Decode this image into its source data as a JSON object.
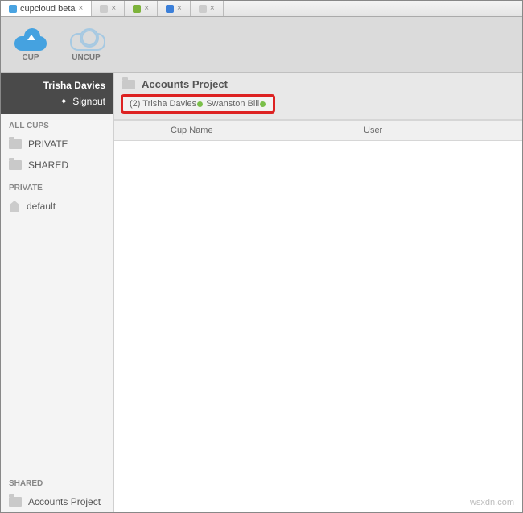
{
  "tabs": [
    {
      "label": "cupcloud beta",
      "favClass": ""
    },
    {
      "label": "",
      "favClass": "g"
    },
    {
      "label": "",
      "favClass": "gr"
    },
    {
      "label": "",
      "favClass": "bl"
    },
    {
      "label": "",
      "favClass": "g"
    }
  ],
  "toolbar": {
    "cup": "CUP",
    "uncup": "UNCUP"
  },
  "user": {
    "name": "Trisha Davies",
    "signout": "Signout"
  },
  "sidebar": {
    "allcups_header": "ALL CUPS",
    "private_label": "PRIVATE",
    "shared_label": "SHARED",
    "private_header": "PRIVATE",
    "default_label": "default",
    "shared_header": "SHARED",
    "accounts_label": "Accounts Project"
  },
  "content": {
    "title": "Accounts Project",
    "members_prefix": "(2) Trisha Davies",
    "members_suffix": " Swanston Bill",
    "cols": {
      "name": "Cup Name",
      "user": "User"
    }
  },
  "watermark": "wsxdn.com"
}
